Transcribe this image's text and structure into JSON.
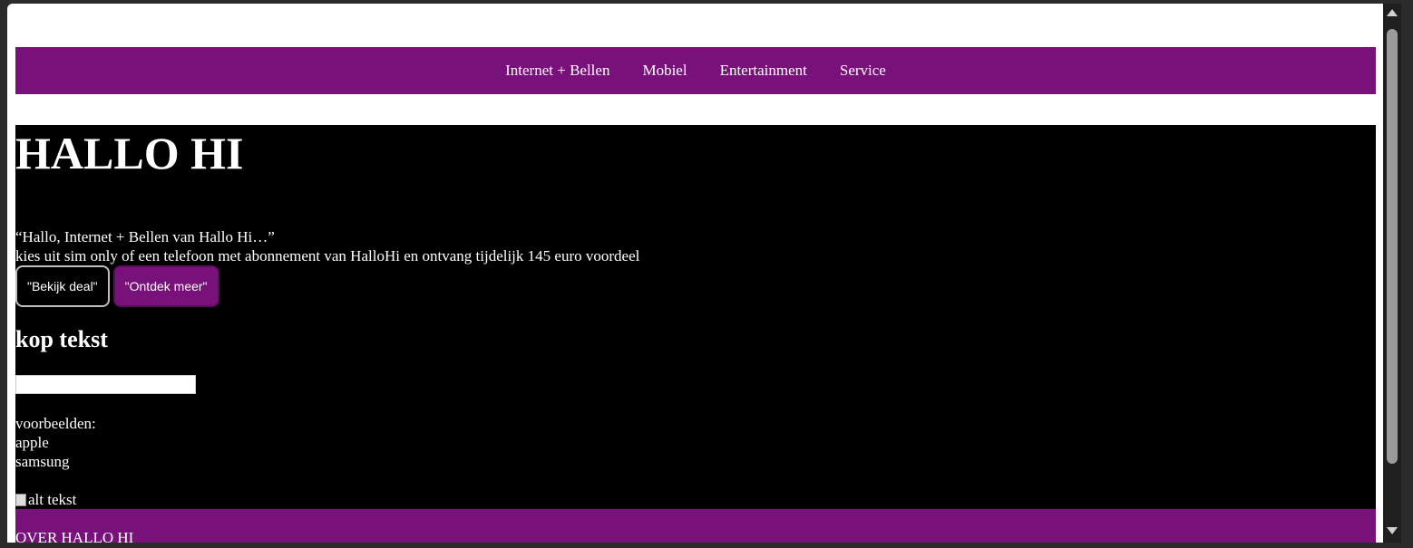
{
  "nav": {
    "items": [
      "Internet + Bellen",
      "Mobiel",
      "Entertainment",
      "Service"
    ]
  },
  "hero": {
    "title": "HALLO HI",
    "quote": "“Hallo, Internet + Bellen van Hallo Hi…”",
    "subline": "kies uit sim only of een telefoon met abonnement van HalloHi en ontvang tijdelijk 145 euro voordeel",
    "deal_button": "\"Bekijk deal\"",
    "meer_button": "\"Ontdek meer\"",
    "kop": "kop tekst",
    "search_value": "",
    "examples": [
      "voorbeelden:",
      "apple",
      "samsung"
    ],
    "image_alt": "alt tekst"
  },
  "footer": {
    "title": "OVER HALLO HI"
  },
  "colors": {
    "brand_purple": "#78127a",
    "hero_bg": "#000000"
  }
}
